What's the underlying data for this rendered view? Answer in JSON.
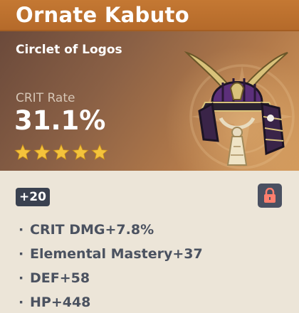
{
  "artifact": {
    "name": "Ornate Kabuto",
    "slot": "Circlet of Logos",
    "main_stat": {
      "label": "CRIT Rate",
      "value": "31.1%"
    },
    "rarity": 5,
    "level": "+20",
    "locked": true,
    "substats": [
      {
        "text": "CRIT DMG+7.8%"
      },
      {
        "text": "Elemental Mastery+37"
      },
      {
        "text": "DEF+58"
      },
      {
        "text": "HP+448"
      }
    ]
  },
  "colors": {
    "titlebar": "#c47833",
    "star": "#f4c33b",
    "badge": "#3a4150",
    "lock_icon": "#ff7f6e",
    "substat_text": "#4b5260"
  },
  "icons": {
    "star": "star-icon",
    "lock": "lock-icon",
    "artifact": "kabuto-helmet-icon"
  }
}
